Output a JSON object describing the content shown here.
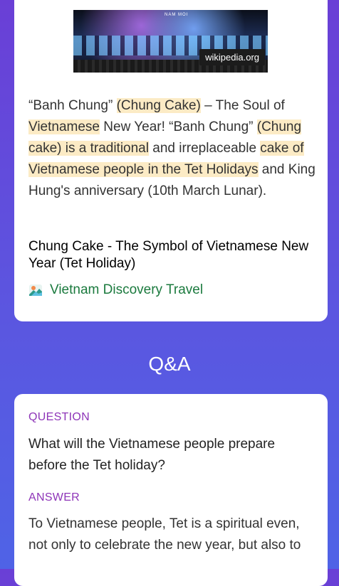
{
  "result_card": {
    "image": {
      "source_label": "wikipedia.org",
      "sign_text": "NAM MOI"
    },
    "snippet": [
      {
        "text": "“Banh Chung” ",
        "highlight": false
      },
      {
        "text": "(Chung Cake)",
        "highlight": true
      },
      {
        "text": " – The Soul of ",
        "highlight": false
      },
      {
        "text": "Vietnamese",
        "highlight": true
      },
      {
        "text": " New Year! “Banh Chung” ",
        "highlight": false
      },
      {
        "text": "(Chung cake) is a traditional",
        "highlight": true
      },
      {
        "text": " and irreplaceable ",
        "highlight": false
      },
      {
        "text": "cake of Vietnamese people in the Tet Holidays",
        "highlight": true
      },
      {
        "text": " and King Hung's anniversary (10th March Lunar).",
        "highlight": false
      }
    ],
    "title": "Chung Cake - The Symbol of Vietnamese New Year (Tet Holiday)",
    "source_name": "Vietnam Discovery Travel",
    "source_icon": "landscape-logo-icon"
  },
  "qa": {
    "heading": "Q&A",
    "question_label": "QUESTION",
    "question": "What will the Vietnamese people prepare before the Tet holiday?",
    "answer_label": "ANSWER",
    "answer": "To Vietnamese people, Tet is a spiritual even, not only to celebrate the new year, but also to"
  },
  "colors": {
    "highlight": "#fcebc5",
    "source_green": "#1b7a3e",
    "label_purple": "#8e35b8",
    "background_top": "#6a3fd6",
    "background_bottom": "#4f63e6"
  }
}
